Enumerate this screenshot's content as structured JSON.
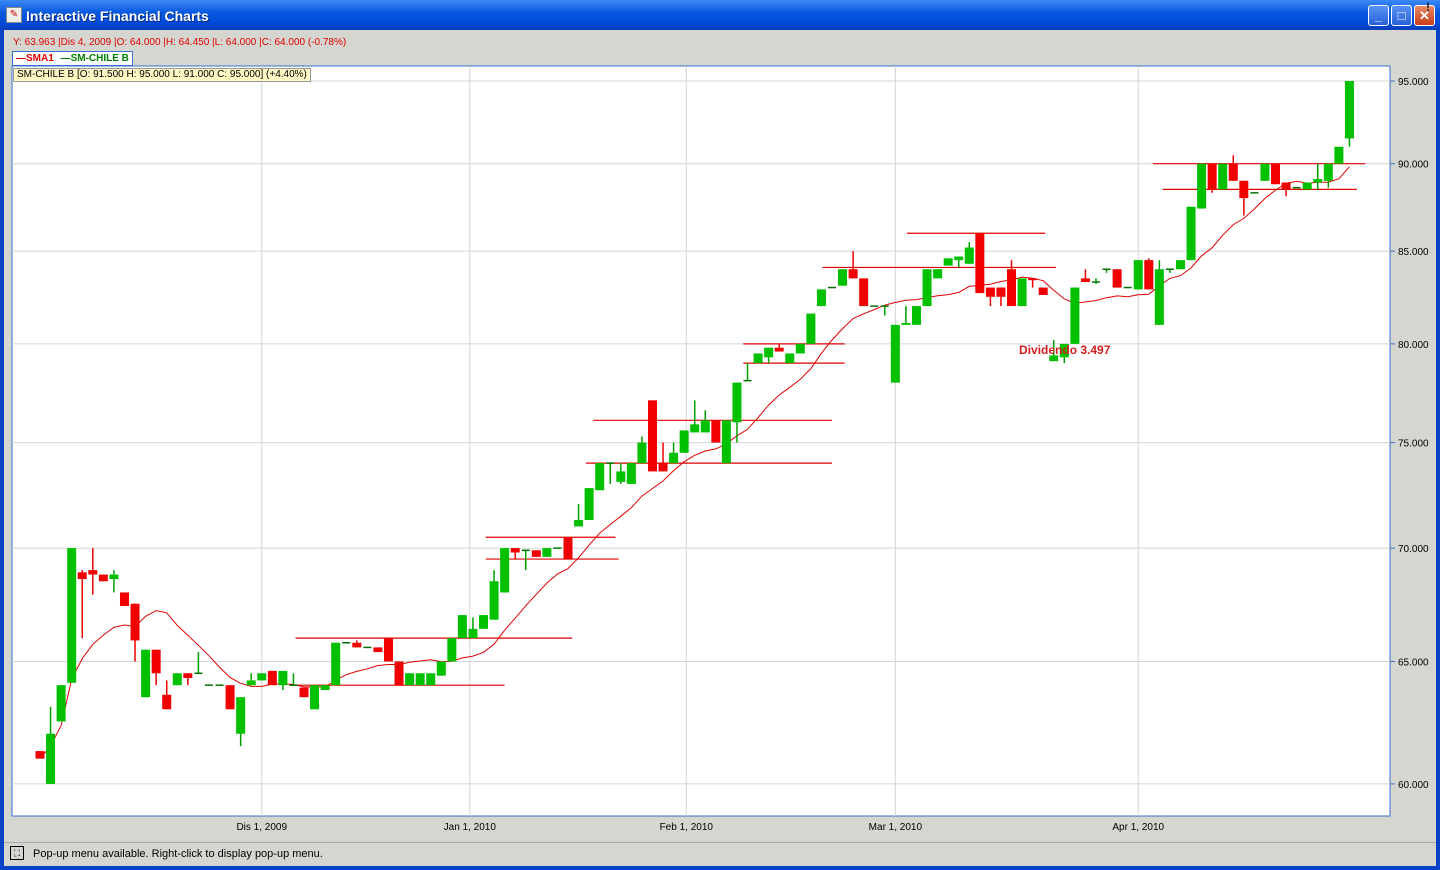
{
  "window": {
    "title": "Interactive Financial Charts",
    "minimize": "_",
    "maximize": "□",
    "close": "✕",
    "warning": "!"
  },
  "info_line": "Y: 63.963 |Dis 4, 2009 |O: 64.000 |H: 64.450 |L: 64.000 |C: 64.000 (-0.78%)",
  "legend": {
    "sma": "SMA1",
    "series": "SM-CHILE B"
  },
  "tooltip": "SM-CHILE B [O: 91.500  H: 95.000  L: 91.000  C: 95.000] (+4.40%)",
  "status": "Pop-up menu available. Right-click to display pop-up menu.",
  "colors": {
    "up": "#00c000",
    "down": "#f00000",
    "sma": "#e00000",
    "level": "#e00000",
    "grid": "#d4d4d4"
  },
  "chart_data": {
    "type": "candlestick",
    "series": "SM-CHILE B",
    "y_scale": "log",
    "ylim": [
      59,
      95.6
    ],
    "y_ticks": [
      "60.000",
      "65.000",
      "70.000",
      "75.000",
      "80.000",
      "85.000",
      "90.000",
      "95.000"
    ],
    "x_ticks": [
      {
        "label": "Dis 1, 2009",
        "index": 21
      },
      {
        "label": "Jan 1, 2010",
        "index": 40.7
      },
      {
        "label": "Feb 1, 2010",
        "index": 61.2
      },
      {
        "label": "Mar 1, 2010",
        "index": 81
      },
      {
        "label": "Apr 1, 2010",
        "index": 104
      }
    ],
    "sma_period": 10,
    "ohlc": [
      [
        61.3,
        61.3,
        61.0,
        61.0
      ],
      [
        60,
        63.1,
        60,
        62.0
      ],
      [
        62.5,
        64,
        62.5,
        64
      ],
      [
        64.1,
        70,
        64.1,
        70
      ],
      [
        68.9,
        69,
        66,
        68.6
      ],
      [
        69,
        70,
        67.9,
        68.8
      ],
      [
        68.8,
        68.8,
        68.5,
        68.5
      ],
      [
        68.6,
        69,
        68,
        68.8
      ],
      [
        68,
        68,
        67.4,
        67.4
      ],
      [
        67.5,
        67.5,
        65,
        65.9
      ],
      [
        63.5,
        65.5,
        63.5,
        65.5
      ],
      [
        65.5,
        65.5,
        64,
        64.5
      ],
      [
        63.6,
        64.2,
        63,
        63
      ],
      [
        64,
        64.5,
        64,
        64.5
      ],
      [
        64.5,
        64.5,
        64,
        64.3
      ],
      [
        64.5,
        65.4,
        64.5,
        64.5
      ],
      [
        64,
        64,
        64,
        64
      ],
      [
        64,
        64,
        64,
        64
      ],
      [
        64,
        64,
        63,
        63
      ],
      [
        62,
        63.5,
        61.5,
        63.5
      ],
      [
        64,
        64.5,
        64,
        64.2
      ],
      [
        64.2,
        64.5,
        64.2,
        64.5
      ],
      [
        64.6,
        64.6,
        64,
        64
      ],
      [
        64,
        64.6,
        63.8,
        64.6
      ],
      [
        64,
        64.5,
        64,
        64
      ],
      [
        63.9,
        63.9,
        63.5,
        63.5
      ],
      [
        63,
        64,
        63,
        64
      ],
      [
        63.8,
        64,
        63.8,
        64
      ],
      [
        64,
        65.8,
        64,
        65.8
      ],
      [
        65.8,
        65.8,
        65.8,
        65.8
      ],
      [
        65.8,
        65.9,
        65.6,
        65.6
      ],
      [
        65.6,
        65.6,
        65.6,
        65.6
      ],
      [
        65.6,
        65.6,
        65.4,
        65.4
      ],
      [
        66,
        66,
        65,
        65
      ],
      [
        65,
        65,
        64,
        64
      ],
      [
        64,
        64.5,
        64,
        64.5
      ],
      [
        64,
        64.5,
        64,
        64.5
      ],
      [
        64,
        64.5,
        64,
        64.5
      ],
      [
        64.4,
        65,
        64.4,
        65
      ],
      [
        65,
        66,
        65,
        66
      ],
      [
        66,
        67,
        66,
        67
      ],
      [
        66,
        66.9,
        66,
        66.4
      ],
      [
        66.4,
        67,
        66.4,
        67
      ],
      [
        66.8,
        69,
        66.8,
        68.5
      ],
      [
        68,
        70,
        68,
        70
      ],
      [
        70,
        70,
        69.5,
        69.8
      ],
      [
        69.9,
        69.9,
        69,
        69.9
      ],
      [
        69.9,
        69.9,
        69.6,
        69.6
      ],
      [
        69.6,
        70,
        69.6,
        70
      ],
      [
        70,
        70,
        70,
        70
      ],
      [
        70.5,
        70.5,
        69.5,
        69.5
      ],
      [
        71.0,
        72.05,
        71.0,
        71.3
      ],
      [
        71.3,
        72.8,
        71.3,
        72.8
      ],
      [
        72.7,
        74,
        72.7,
        74
      ],
      [
        74,
        74,
        73,
        74
      ],
      [
        73.1,
        74,
        73,
        73.6
      ],
      [
        73,
        74,
        73,
        74
      ],
      [
        74,
        75.3,
        74,
        75
      ],
      [
        77.1,
        77.1,
        73.6,
        73.6
      ],
      [
        74,
        75,
        73.6,
        73.6
      ],
      [
        74,
        75,
        74,
        74.5
      ],
      [
        74.5,
        75.6,
        74.5,
        75.6
      ],
      [
        75.5,
        77.1,
        75.5,
        75.9
      ],
      [
        75.5,
        76.6,
        75.5,
        76.1
      ],
      [
        76.1,
        76.1,
        75,
        75
      ],
      [
        74,
        76.1,
        74,
        76.1
      ],
      [
        76,
        78,
        75,
        78
      ],
      [
        78.1,
        79,
        78.1,
        78.1
      ],
      [
        79,
        79.5,
        79,
        79.5
      ],
      [
        79.3,
        79.8,
        79,
        79.8
      ],
      [
        79.8,
        80,
        79.6,
        79.6
      ],
      [
        79,
        79.5,
        79,
        79.5
      ],
      [
        79.5,
        80,
        79.5,
        80
      ],
      [
        80,
        81.6,
        80,
        81.6
      ],
      [
        82,
        82.9,
        82,
        82.9
      ],
      [
        83,
        83,
        83,
        83
      ],
      [
        83.1,
        84,
        83.1,
        84
      ],
      [
        84,
        85,
        83.5,
        83.5
      ],
      [
        83.5,
        83.5,
        82,
        82
      ],
      [
        82,
        82,
        82,
        82
      ],
      [
        82,
        82,
        81.5,
        82
      ],
      [
        78,
        81,
        78,
        81
      ],
      [
        81,
        82,
        81,
        81.1
      ],
      [
        81,
        82,
        81,
        82
      ],
      [
        82,
        84,
        82,
        84
      ],
      [
        83.5,
        84,
        83.5,
        84
      ],
      [
        84.2,
        84.6,
        84.2,
        84.6
      ],
      [
        84.5,
        84.7,
        84.1,
        84.7
      ],
      [
        84.3,
        85.5,
        84.3,
        85.2
      ],
      [
        86,
        86,
        82.7,
        82.7
      ],
      [
        83,
        83,
        82,
        82.5
      ],
      [
        83,
        83,
        82,
        82.5
      ],
      [
        84,
        84.5,
        82,
        82
      ],
      [
        82,
        83.5,
        82,
        83.5
      ],
      [
        83.5,
        83.5,
        83,
        83.4
      ],
      [
        83,
        83,
        82.6,
        82.6
      ],
      [
        79.1,
        80.2,
        79.1,
        79.4
      ],
      [
        79.3,
        80,
        79,
        80
      ],
      [
        80,
        83,
        80,
        83
      ],
      [
        83.5,
        84,
        83.3,
        83.3
      ],
      [
        83.3,
        83.5,
        83.2,
        83.3
      ],
      [
        84,
        84,
        83.8,
        84
      ],
      [
        84,
        84,
        83,
        83
      ],
      [
        83,
        83,
        83,
        83
      ],
      [
        82.9,
        84.5,
        82.9,
        84.5
      ],
      [
        84.5,
        84.6,
        82.9,
        82.9
      ],
      [
        81,
        84.5,
        81,
        84
      ],
      [
        84,
        84,
        83.8,
        84
      ],
      [
        84,
        84.5,
        84,
        84.5
      ],
      [
        84.5,
        87.5,
        84.5,
        87.5
      ],
      [
        87.4,
        90,
        87.4,
        90
      ],
      [
        90,
        90,
        88.3,
        88.5
      ],
      [
        88.5,
        90,
        88.5,
        90
      ],
      [
        90,
        90.5,
        89,
        89
      ],
      [
        89,
        89,
        87,
        88
      ],
      [
        88.3,
        88.3,
        88.3,
        88.3
      ],
      [
        89,
        90,
        89,
        90
      ],
      [
        90,
        90,
        88.8,
        88.8
      ],
      [
        88.9,
        88.9,
        88.1,
        88.5
      ],
      [
        88.6,
        88.6,
        88.6,
        88.6
      ],
      [
        88.5,
        88.9,
        88.5,
        88.9
      ],
      [
        88.9,
        90,
        88.5,
        89.1
      ],
      [
        89,
        90,
        88.6,
        90
      ],
      [
        90,
        91,
        90,
        91
      ],
      [
        91.5,
        95,
        91,
        95
      ]
    ],
    "levels": [
      [
        66.0,
        24.2,
        50.4
      ],
      [
        64.0,
        24.2,
        44
      ],
      [
        70.5,
        42.2,
        54.5
      ],
      [
        69.5,
        42.2,
        54.8
      ],
      [
        76.1,
        52.4,
        75
      ],
      [
        74.0,
        51.7,
        75
      ],
      [
        80.0,
        66.6,
        76.2
      ],
      [
        79.0,
        66.6,
        76.2
      ],
      [
        84.1,
        74.1,
        96.2
      ],
      [
        86.0,
        82.1,
        95.2
      ],
      [
        90.0,
        105.4,
        125.5
      ],
      [
        88.5,
        106.3,
        124.7
      ]
    ],
    "annotation": {
      "text": "Dividendo 3.497",
      "index": 96.5,
      "price": 80.0
    }
  }
}
